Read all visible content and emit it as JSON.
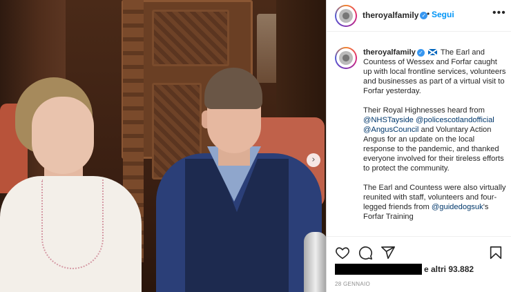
{
  "post": {
    "username": "theroyalfamily",
    "dot": "•",
    "follow_label": "Segui",
    "more_icon": "more-horizontal-icon",
    "next_icon": "chevron-right-icon"
  },
  "caption": {
    "username": "theroyalfamily",
    "flag": "scotland-flag",
    "paragraph1": "The Earl and Countess of Wessex and Forfar caught up with local frontline services, volunteers and businesses as part of a virtual visit to Forfar yesterday.",
    "p2_intro": "Their Royal Highnesses heard from",
    "mention_nhs": "@NHSTayside",
    "mention_police": "@policescotlandofficial",
    "mention_angus": "@AngusCouncil",
    "p2_rest": "and Voluntary Action Angus for an update on the local response to the pandemic, and thanked everyone involved for their tireless efforts to protect the community.",
    "paragraph3": "The Earl and Countess were also virtually reunited with staff, volunteers and four-legged friends from",
    "mention_guidedogs": "@guidedogsuk",
    "p3_rest": "'s Forfar Training"
  },
  "actions": {
    "icons": [
      "heart-icon",
      "comment-icon",
      "share-icon",
      "bookmark-icon"
    ],
    "likes_text": "e altri 93.882",
    "date": "28 GENNAIO"
  },
  "colors": {
    "accent": "#0095f6",
    "verified": "#3897f0",
    "mention": "#00376b",
    "text": "#262626",
    "muted": "#8e8e8e"
  }
}
